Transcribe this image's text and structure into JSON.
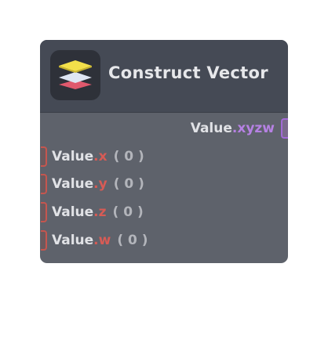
{
  "node": {
    "title": "Construct Vector",
    "icon": "layers-stack-icon",
    "colors": {
      "header": "#454a55",
      "body": "#5e626b",
      "icon_yellow": "#f2df4a",
      "icon_white": "#dfe6f3",
      "icon_red": "#e0596d",
      "component": "#d75b55",
      "output_component": "#b681e3"
    },
    "output": {
      "label": "Value",
      "component": ".xyzw"
    },
    "inputs": [
      {
        "label": "Value",
        "component": ".x",
        "default": "( 0 )"
      },
      {
        "label": "Value",
        "component": ".y",
        "default": "( 0 )"
      },
      {
        "label": "Value",
        "component": ".z",
        "default": "( 0 )"
      },
      {
        "label": "Value",
        "component": ".w",
        "default": "( 0 )"
      }
    ]
  }
}
